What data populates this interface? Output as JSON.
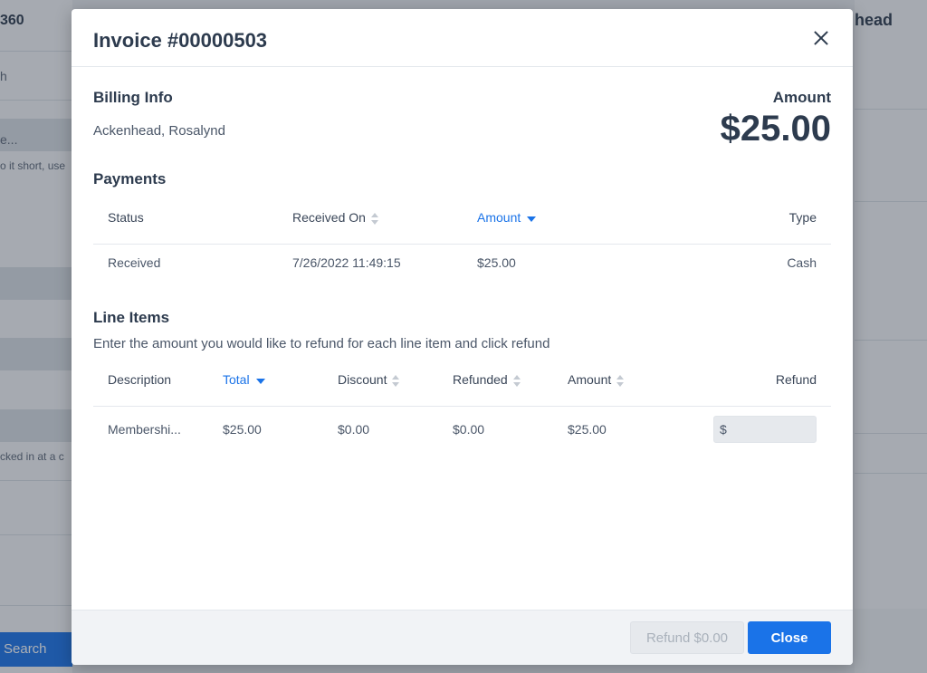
{
  "background": {
    "left_title": "360",
    "left_search_stub": "h",
    "left_field_stub": "e...",
    "left_hint": "o it short, use",
    "left_note": "cked in at a c",
    "search_button": "Search",
    "right_title": "head"
  },
  "modal": {
    "title": "Invoice #00000503",
    "billing": {
      "heading": "Billing Info",
      "name": "Ackenhead, Rosalynd"
    },
    "amount": {
      "label": "Amount",
      "value": "$25.00"
    },
    "payments": {
      "heading": "Payments",
      "columns": {
        "status": "Status",
        "received_on": "Received On",
        "amount": "Amount",
        "type": "Type"
      },
      "rows": [
        {
          "status": "Received",
          "received_on": "7/26/2022 11:49:15",
          "amount": "$25.00",
          "type": "Cash"
        }
      ]
    },
    "line_items": {
      "heading": "Line Items",
      "subtitle": "Enter the amount you would like to refund for each line item and click refund",
      "columns": {
        "description": "Description",
        "total": "Total",
        "discount": "Discount",
        "refunded": "Refunded",
        "amount": "Amount",
        "refund": "Refund"
      },
      "rows": [
        {
          "description": "Membershi...",
          "total": "$25.00",
          "discount": "$0.00",
          "refunded": "$0.00",
          "amount": "$25.00",
          "refund_value": "$"
        }
      ]
    },
    "footer": {
      "refund_button": "Refund $0.00",
      "close_button": "Close"
    }
  },
  "colors": {
    "accent": "#1a73e8",
    "text": "#2d3b4e",
    "muted": "#4a5668"
  }
}
